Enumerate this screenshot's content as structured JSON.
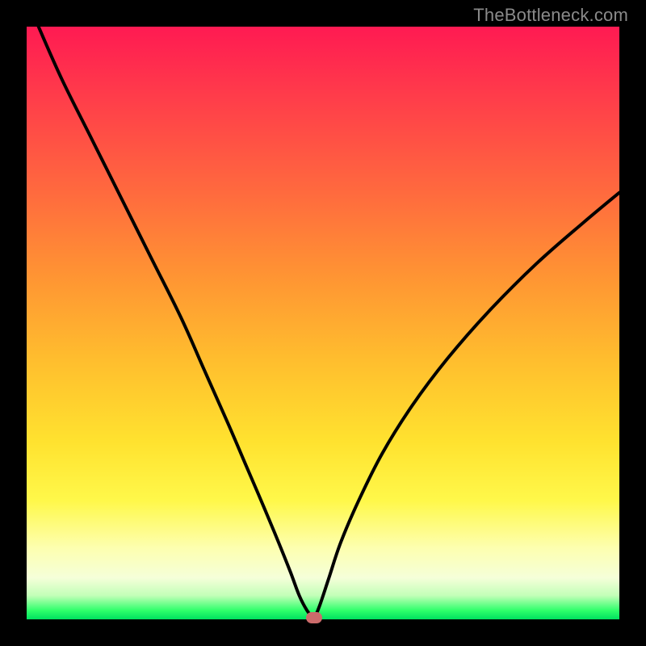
{
  "watermark": "TheBottleneck.com",
  "colors": {
    "frame": "#000000",
    "curve": "#000000",
    "dot": "#cc6b6b",
    "gradient_top": "#ff1a52",
    "gradient_mid": "#ffe22f",
    "gradient_bottom": "#00e060"
  },
  "chart_data": {
    "type": "line",
    "title": "",
    "xlabel": "",
    "ylabel": "",
    "xlim": [
      0,
      100
    ],
    "ylim": [
      0,
      100
    ],
    "legend": false,
    "grid": false,
    "annotations": [
      {
        "type": "marker",
        "x": 48.5,
        "y": 0,
        "label": "optimal-point"
      }
    ],
    "series": [
      {
        "name": "left-branch",
        "x": [
          2,
          6,
          11,
          16,
          21,
          26,
          30,
          34,
          37,
          40,
          42.5,
          44.5,
          46,
          47.3,
          48.5
        ],
        "y": [
          100,
          91,
          81,
          71,
          61,
          51,
          42,
          33,
          26,
          19,
          13,
          8,
          4,
          1.5,
          0
        ]
      },
      {
        "name": "right-branch",
        "x": [
          48.5,
          49.5,
          51,
          53,
          56,
          60,
          65,
          71,
          78,
          86,
          94,
          100
        ],
        "y": [
          0,
          2.5,
          7,
          13,
          20,
          28,
          36,
          44,
          52,
          60,
          67,
          72
        ]
      }
    ]
  }
}
